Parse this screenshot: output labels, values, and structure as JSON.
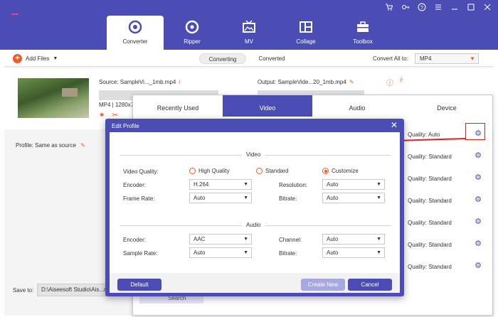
{
  "window": {
    "controls": [
      "cart-icon",
      "key-icon",
      "help-icon",
      "menu-icon",
      "minimize-icon",
      "close-icon"
    ]
  },
  "nav": {
    "items": [
      {
        "label": "Converter",
        "active": true
      },
      {
        "label": "Ripper"
      },
      {
        "label": "MV"
      },
      {
        "label": "Collage"
      },
      {
        "label": "Toolbox"
      }
    ]
  },
  "toolbar": {
    "add_files": "Add Files",
    "tabs": [
      "Converting",
      "Converted"
    ],
    "convert_all_label": "Convert All to:",
    "convert_all_value": "MP4"
  },
  "file": {
    "source": "Source: SampleVi..._1mb.mp4",
    "output": "Output: SampleVide...20_1mb.mp4",
    "meta": "MP4 | 1280x72"
  },
  "save": {
    "label": "Save to:",
    "path": "D:\\Aiseesoft Studio\\Ais...r"
  },
  "format_panel": {
    "tabs": [
      "Recently Used",
      "Video",
      "Audio",
      "Device"
    ],
    "active_tab": "Video",
    "rows": [
      "Quality: Auto",
      "Quality: Standard",
      "Quality: Standard",
      "Quality: Standard",
      "Quality: Standard",
      "Quality: Standard",
      "Quality: Standard"
    ],
    "search": "Search"
  },
  "dialog": {
    "title": "Edit Profile",
    "profile": "Profile:  Same as source",
    "video_section": "Video",
    "audio_section": "Audio",
    "video_quality_label": "Video Quality:",
    "quality_options": [
      "High Quality",
      "Standard",
      "Customize"
    ],
    "quality_selected": "Customize",
    "encoder_label": "Encoder:",
    "encoder_value": "H.264",
    "resolution_label": "Resolution:",
    "resolution_value": "Auto",
    "frame_rate_label": "Frame Rate:",
    "frame_rate_value": "Auto",
    "bitrate_label": "Bitrate:",
    "bitrate_value": "Auto",
    "audio_encoder_label": "Encoder:",
    "audio_encoder_value": "AAC",
    "channel_label": "Channel:",
    "channel_value": "Auto",
    "sample_rate_label": "Sample Rate:",
    "sample_rate_value": "Auto",
    "audio_bitrate_label": "Bitrate:",
    "audio_bitrate_value": "Auto",
    "default_btn": "Default",
    "create_btn": "Create New",
    "cancel_btn": "Cancel"
  },
  "colors": {
    "brand": "#4b4db5",
    "accent": "#f05a28",
    "highlight": "#e02020"
  }
}
